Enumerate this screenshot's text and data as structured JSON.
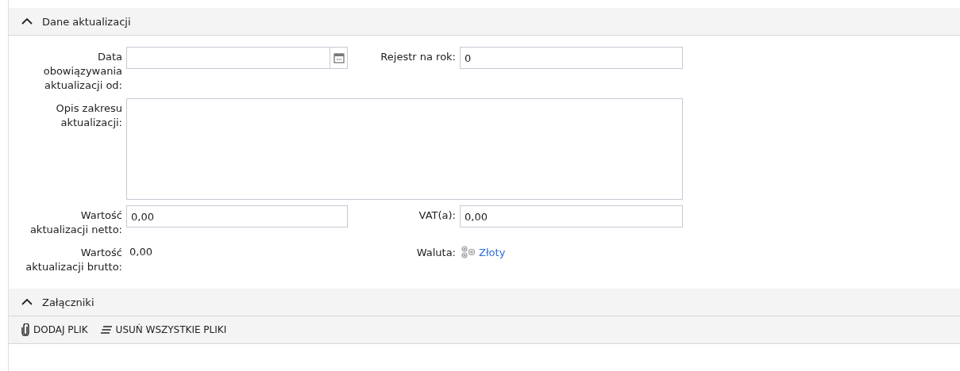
{
  "sections": [
    {
      "title": "Dane aktualizacji",
      "expanded": true,
      "fields": [
        {
          "kind": "date",
          "label": "Data obowiązywania aktualizacji od:"
        },
        {
          "kind": "text",
          "label": "Rejestr na rok:",
          "value": "0"
        },
        {
          "kind": "textarea",
          "label": "Opis zakresu aktualizacji:"
        },
        {
          "kind": "text",
          "label": "Wartość aktualizacji netto:",
          "value": "0,00"
        },
        {
          "kind": "text",
          "label": "VAT(a):",
          "value": "0,00"
        },
        {
          "kind": "static",
          "label": "Wartość aktualizacji brutto:",
          "value": "0,00"
        },
        {
          "kind": "link",
          "label": "Waluta:",
          "value": "Złoty"
        }
      ]
    },
    {
      "title": "Załączniki",
      "expanded": true,
      "toolbar": [
        {
          "kind": "attach",
          "label": "DODAJ PLIK"
        },
        {
          "kind": "clear",
          "label": "USUŃ WSZYSTKIE PLIKI"
        }
      ]
    }
  ]
}
